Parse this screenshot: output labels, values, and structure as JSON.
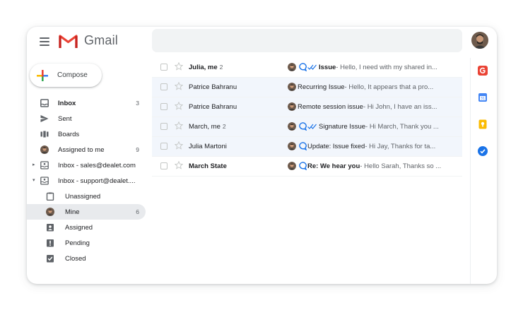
{
  "app": {
    "name": "Gmail"
  },
  "search": {
    "placeholder": ""
  },
  "compose": {
    "label": "Compose"
  },
  "colors": {
    "gmail_red": "#EA4335",
    "gmail_blue": "#4285F4",
    "gmail_green": "#34A853",
    "gmail_yellow": "#FBBC04",
    "row_read_bg": "#f2f6fc",
    "active_nav_bg": "#e8eaed",
    "chat_blue": "#1a73e8"
  },
  "sidebar": {
    "items": [
      {
        "label": "Inbox",
        "count": "3",
        "icon": "inbox-icon"
      },
      {
        "label": "Sent",
        "count": "",
        "icon": "send-icon"
      },
      {
        "label": "Boards",
        "count": "",
        "icon": "boards-icon"
      },
      {
        "label": "Assigned to me",
        "count": "9",
        "icon": "avatar-icon"
      },
      {
        "label": "Inbox - sales@dealet.com",
        "count": "",
        "icon": "shared-inbox-icon"
      },
      {
        "label": "Inbox - support@dealet....",
        "count": "",
        "icon": "shared-inbox-icon"
      },
      {
        "label": "Unassigned",
        "count": "",
        "icon": "unassigned-icon"
      },
      {
        "label": "Mine",
        "count": "6",
        "icon": "avatar-icon"
      },
      {
        "label": "Assigned",
        "count": "",
        "icon": "assigned-icon"
      },
      {
        "label": "Pending",
        "count": "",
        "icon": "pending-icon"
      },
      {
        "label": "Closed",
        "count": "",
        "icon": "closed-icon"
      }
    ]
  },
  "emails": [
    {
      "sender": "Julia, me",
      "count": "2",
      "subject": "Issue",
      "snippet": " - Hello, I need with my shared in...",
      "unread": true,
      "chat": true,
      "ticks": true
    },
    {
      "sender": "Patrice Bahranu",
      "count": "",
      "subject": "Recurring Issue",
      "snippet": " - Hello, It appears that a pro...",
      "unread": false,
      "chat": false,
      "ticks": false
    },
    {
      "sender": "Patrice Bahranu",
      "count": "",
      "subject": "Remote session issue",
      "snippet": " - Hi John, I have an iss...",
      "unread": false,
      "chat": false,
      "ticks": false
    },
    {
      "sender": "March, me",
      "count": "2",
      "subject": "Signature Issue",
      "snippet": " - Hi March, Thank you ...",
      "unread": false,
      "chat": true,
      "ticks": true
    },
    {
      "sender": "Julia Martoni",
      "count": "",
      "subject": "Update: Issue fixed",
      "snippet": " - Hi Jay, Thanks for ta...",
      "unread": false,
      "chat": true,
      "ticks": false
    },
    {
      "sender": "March State",
      "count": "",
      "subject": "Re: We hear you",
      "snippet": " - Hello Sarah, Thanks so ...",
      "unread": true,
      "chat": true,
      "ticks": false
    }
  ],
  "rail": {
    "icons": [
      {
        "name": "dealet-addon-icon",
        "color": "#EA4335"
      },
      {
        "name": "calendar-icon",
        "color": "#4285F4"
      },
      {
        "name": "keep-icon",
        "color": "#FBBC04"
      },
      {
        "name": "tasks-icon",
        "color": "#1a73e8"
      }
    ]
  }
}
